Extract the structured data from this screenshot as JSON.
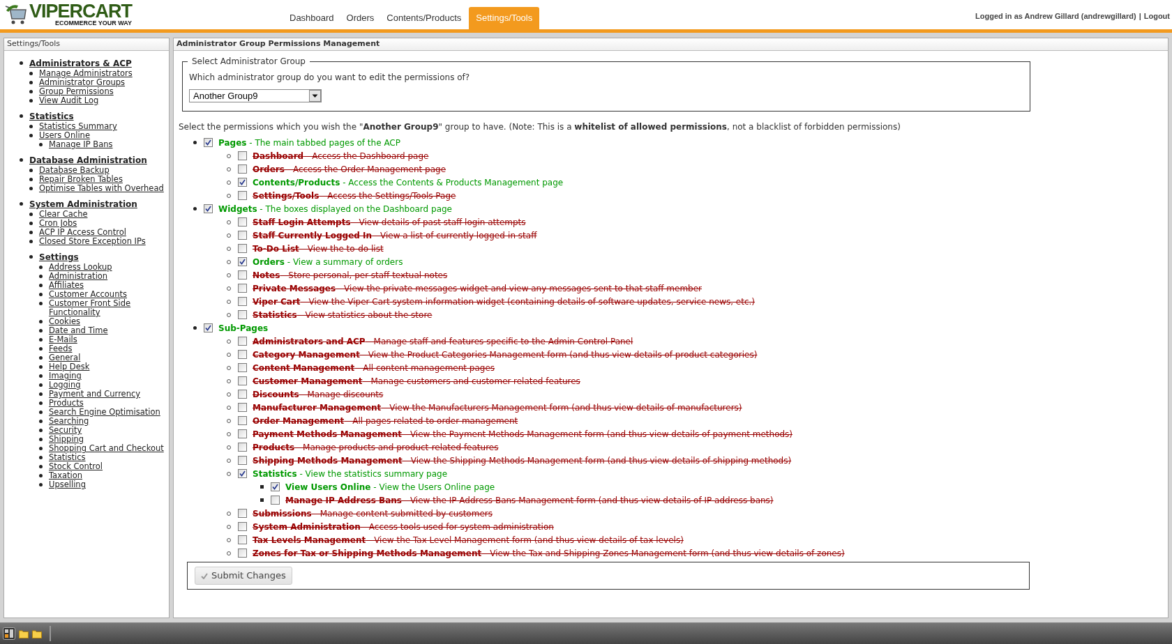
{
  "logo": {
    "name": "VIPERCART",
    "tagline": "ECOMMERCE YOUR WAY"
  },
  "nav": [
    {
      "label": "Dashboard",
      "selected": false
    },
    {
      "label": "Orders",
      "selected": false
    },
    {
      "label": "Contents/Products",
      "selected": false
    },
    {
      "label": "Settings/Tools",
      "selected": true
    }
  ],
  "user": {
    "logged_in": "Logged in as Andrew Gillard (andrewgillard)",
    "separator": "|",
    "logout": "Logout"
  },
  "sidebar": {
    "title": "Settings/Tools",
    "items": [
      {
        "label": "Administrators & ACP",
        "children": [
          {
            "label": "Manage Administrators"
          },
          {
            "label": "Administrator Groups"
          },
          {
            "label": "Group Permissions"
          },
          {
            "label": "View Audit Log"
          }
        ]
      },
      {
        "label": "Statistics",
        "children": [
          {
            "label": "Statistics Summary"
          },
          {
            "label": "Users Online",
            "children": [
              {
                "label": "Manage IP Bans"
              }
            ]
          }
        ]
      },
      {
        "label": "Database Administration",
        "children": [
          {
            "label": "Database Backup"
          },
          {
            "label": "Repair Broken Tables"
          },
          {
            "label": "Optimise Tables with Overhead"
          }
        ]
      },
      {
        "label": "System Administration",
        "children": [
          {
            "label": "Clear Cache",
            "kind": "link"
          },
          {
            "label": "Cron Jobs",
            "kind": "link"
          },
          {
            "label": "ACP IP Access Control",
            "kind": "link"
          },
          {
            "label": "Closed Store Exception IPs",
            "kind": "link"
          },
          {
            "label": "Settings",
            "kind": "heading",
            "children": [
              {
                "label": "Address Lookup"
              },
              {
                "label": "Administration"
              },
              {
                "label": "Affiliates"
              },
              {
                "label": "Customer Accounts"
              },
              {
                "label": "Customer Front Side Functionality"
              },
              {
                "label": "Cookies"
              },
              {
                "label": "Date and Time"
              },
              {
                "label": "E-Mails"
              },
              {
                "label": "Feeds"
              },
              {
                "label": "General"
              },
              {
                "label": "Help Desk"
              },
              {
                "label": "Imaging"
              },
              {
                "label": "Logging"
              },
              {
                "label": "Payment and Currency"
              },
              {
                "label": "Products"
              },
              {
                "label": "Search Engine Optimisation"
              },
              {
                "label": "Searching"
              },
              {
                "label": "Security"
              },
              {
                "label": "Shipping"
              },
              {
                "label": "Shopping Cart and Checkout"
              },
              {
                "label": "Statistics"
              },
              {
                "label": "Stock Control"
              },
              {
                "label": "Taxation"
              },
              {
                "label": "Upselling"
              }
            ]
          }
        ]
      }
    ]
  },
  "main": {
    "title": "Administrator Group Permissions Management",
    "group_select": {
      "legend": "Select Administrator Group",
      "question": "Which administrator group do you want to edit the permissions of?",
      "value": "Another Group9"
    },
    "intro": "Select the permissions which you wish the \"**Another Group9**\" group to have. (Note: This is a **whitelist of allowed permissions**, not a blacklist of forbidden permissions)",
    "permissions": [
      {
        "name": "Pages",
        "description": "- The main tabbed pages of the ACP",
        "checked": true,
        "children": [
          {
            "name": "Dashboard",
            "description": "- Access the Dashboard page",
            "checked": false
          },
          {
            "name": "Orders",
            "description": "- Access the Order Management page",
            "checked": false
          },
          {
            "name": "Contents/Products",
            "description": "- Access the Contents & Products Management page",
            "checked": true
          },
          {
            "name": "Settings/Tools",
            "description": "- Access the Settings/Tools Page",
            "checked": false
          }
        ]
      },
      {
        "name": "Widgets",
        "description": "- The boxes displayed on the Dashboard page",
        "checked": true,
        "children": [
          {
            "name": "Staff Login Attempts",
            "description": "- View details of past staff login attempts",
            "checked": false
          },
          {
            "name": "Staff Currently Logged In",
            "description": "- View a list of currently logged-in staff",
            "checked": false
          },
          {
            "name": "To-Do List",
            "description": "- View the to-do list",
            "checked": false
          },
          {
            "name": "Orders",
            "description": "- View a summary of orders",
            "checked": true
          },
          {
            "name": "Notes",
            "description": "- Store personal, per-staff textual notes",
            "checked": false
          },
          {
            "name": "Private Messages",
            "description": "- View the private messages widget and view any messages sent to that staff member",
            "checked": false
          },
          {
            "name": "Viper Cart",
            "description": "- View the Viper Cart system information widget (containing details of software updates, service news, etc.)",
            "checked": false
          },
          {
            "name": "Statistics",
            "description": "- View statistics about the store",
            "checked": false
          }
        ]
      },
      {
        "name": "Sub-Pages",
        "checked": true,
        "children": [
          {
            "name": "Administrators and ACP",
            "description": "- Manage staff and features specific to the Admin Control Panel",
            "checked": false
          },
          {
            "name": "Category Management",
            "description": "- View the Product Categories Management form (and thus view details of product categories)",
            "checked": false
          },
          {
            "name": "Content Management",
            "description": "- All content management pages",
            "checked": false
          },
          {
            "name": "Customer Management",
            "description": "- Manage customers and customer-related features",
            "checked": false
          },
          {
            "name": "Discounts",
            "description": "- Manage discounts",
            "checked": false
          },
          {
            "name": "Manufacturer Management",
            "description": "- View the Manufacturers Management form (and thus view details of manufacturers)",
            "checked": false
          },
          {
            "name": "Order Management",
            "description": "- All pages related to order management",
            "checked": false
          },
          {
            "name": "Payment Methods Management",
            "description": "- View the Payment Methods Management form (and thus view details of payment methods)",
            "checked": false
          },
          {
            "name": "Products",
            "description": "- Manage products and product-related features",
            "checked": false
          },
          {
            "name": "Shipping Methods Management",
            "description": "- View the Shipping Methods Management form (and thus view details of shipping methods)",
            "checked": false
          },
          {
            "name": "Statistics",
            "description": "- View the statistics summary page",
            "checked": true,
            "children": [
              {
                "name": "View Users Online",
                "description": "- View the Users Online page",
                "checked": true
              },
              {
                "name": "Manage IP Address Bans",
                "description": "- View the IP Address Bans Management form (and thus view details of IP address bans)",
                "checked": false
              }
            ]
          },
          {
            "name": "Submissions",
            "description": "- Manage content submitted by customers",
            "checked": false
          },
          {
            "name": "System Administration",
            "description": "- Access tools used for system administration",
            "checked": false
          },
          {
            "name": "Tax Levels Management",
            "description": "- View the Tax Level Management form (and thus view details of tax levels)",
            "checked": false
          },
          {
            "name": "Zones for Tax or Shipping Methods Management",
            "description": "- View the Tax and Shipping Zones Management form (and thus view details of zones)",
            "checked": false
          }
        ]
      }
    ],
    "submit": "Submit Changes"
  }
}
